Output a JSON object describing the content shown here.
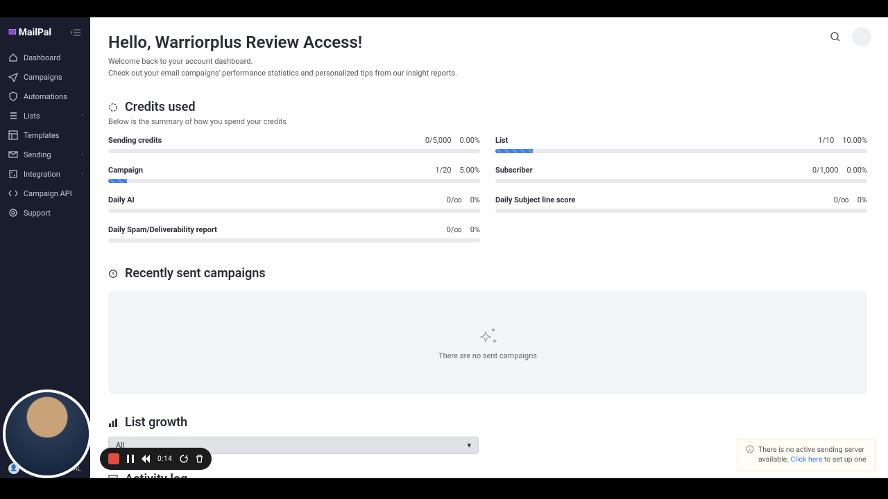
{
  "brand": {
    "name": "MailPal"
  },
  "sidebar": {
    "items": [
      {
        "label": "Dashboard",
        "icon": "home"
      },
      {
        "label": "Campaigns",
        "icon": "send"
      },
      {
        "label": "Automations",
        "icon": "shield"
      },
      {
        "label": "Lists",
        "icon": "list",
        "hasSub": true
      },
      {
        "label": "Templates",
        "icon": "template"
      },
      {
        "label": "Sending",
        "icon": "mail",
        "hasSub": true
      },
      {
        "label": "Integration",
        "icon": "plug",
        "hasSub": true
      },
      {
        "label": "Campaign API",
        "icon": "code"
      },
      {
        "label": "Support",
        "icon": "support"
      }
    ]
  },
  "header": {
    "greeting": "Hello, Warriorplus Review Access!",
    "sub1": "Welcome back to your account dashboard.",
    "sub2": "Check out your email campaigns' performance statistics and personalized tips from our insight reports."
  },
  "credits": {
    "title": "Credits used",
    "subtitle": "Below is the summary of how you spend your credits",
    "rows": [
      {
        "label": "Sending credits",
        "count": "0/5,000",
        "pct": "0.00%",
        "fill": 0
      },
      {
        "label": "List",
        "count": "1/10",
        "pct": "10.00%",
        "fill": 10
      },
      {
        "label": "Campaign",
        "count": "1/20",
        "pct": "5.00%",
        "fill": 5
      },
      {
        "label": "Subscriber",
        "count": "0/1,000",
        "pct": "0.00%",
        "fill": 0
      },
      {
        "label": "Daily AI",
        "count": "0/∞",
        "pct": "0%",
        "fill": 0
      },
      {
        "label": "Daily Subject line score",
        "count": "0/∞",
        "pct": "0%",
        "fill": 0
      },
      {
        "label": "Daily Spam/Deliverability report",
        "count": "0/∞",
        "pct": "0%",
        "fill": 0
      }
    ]
  },
  "recent": {
    "title": "Recently sent campaigns",
    "empty": "There are no sent campaigns"
  },
  "listGrowth": {
    "title": "List growth",
    "selected": "All"
  },
  "activity": {
    "title": "Activity log"
  },
  "recorder": {
    "time": "0:14"
  },
  "toast": {
    "text1": "There is no active sending server available. ",
    "link": "Click here",
    "text2": " to set up one"
  },
  "miniLabel": "AL"
}
